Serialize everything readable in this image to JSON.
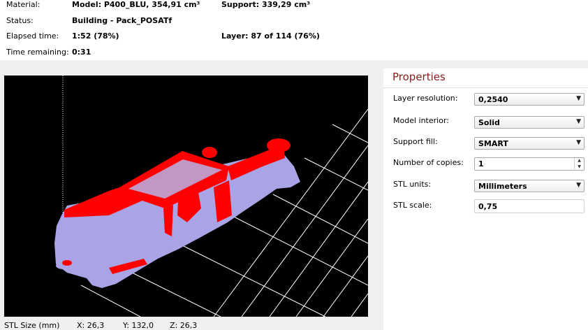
{
  "status": {
    "material_label": "Material:",
    "model_text": "Model: P400_BLU, 354,91 cm³",
    "support_text": "Support: 339,29 cm³",
    "status_label": "Status:",
    "status_value": "Building - Pack_POSATf",
    "elapsed_label": "Elapsed time:",
    "elapsed_value": "1:52  (78%)",
    "layer_text": "Layer: 87 of 114  (76%)",
    "remaining_label": "Time remaining:",
    "remaining_value": "0:31"
  },
  "stl_size": {
    "label": "STL Size (mm)",
    "x": "X:  26,3",
    "y": "Y:  132,0",
    "z": "Z:  26,3"
  },
  "properties": {
    "title": "Properties",
    "layer_resolution": {
      "label": "Layer resolution:",
      "value": "0,2540"
    },
    "model_interior": {
      "label": "Model interior:",
      "value": "Solid"
    },
    "support_fill": {
      "label": "Support fill:",
      "value": "SMART"
    },
    "number_of_copies": {
      "label": "Number of copies:",
      "value": "1"
    },
    "stl_units": {
      "label": "STL units:",
      "value": "Millimeters"
    },
    "stl_scale": {
      "label": "STL scale:",
      "value": "0,75"
    }
  },
  "colors": {
    "viewport_background": "#000000",
    "grid": "#ffffff",
    "model": "#ff0000",
    "support": "#a9a4e6",
    "properties_title": "#8b1a1a"
  },
  "icons": {
    "dropdown_arrow": "chevron-down-icon",
    "spin_up": "caret-up-icon",
    "spin_down": "caret-down-icon"
  }
}
